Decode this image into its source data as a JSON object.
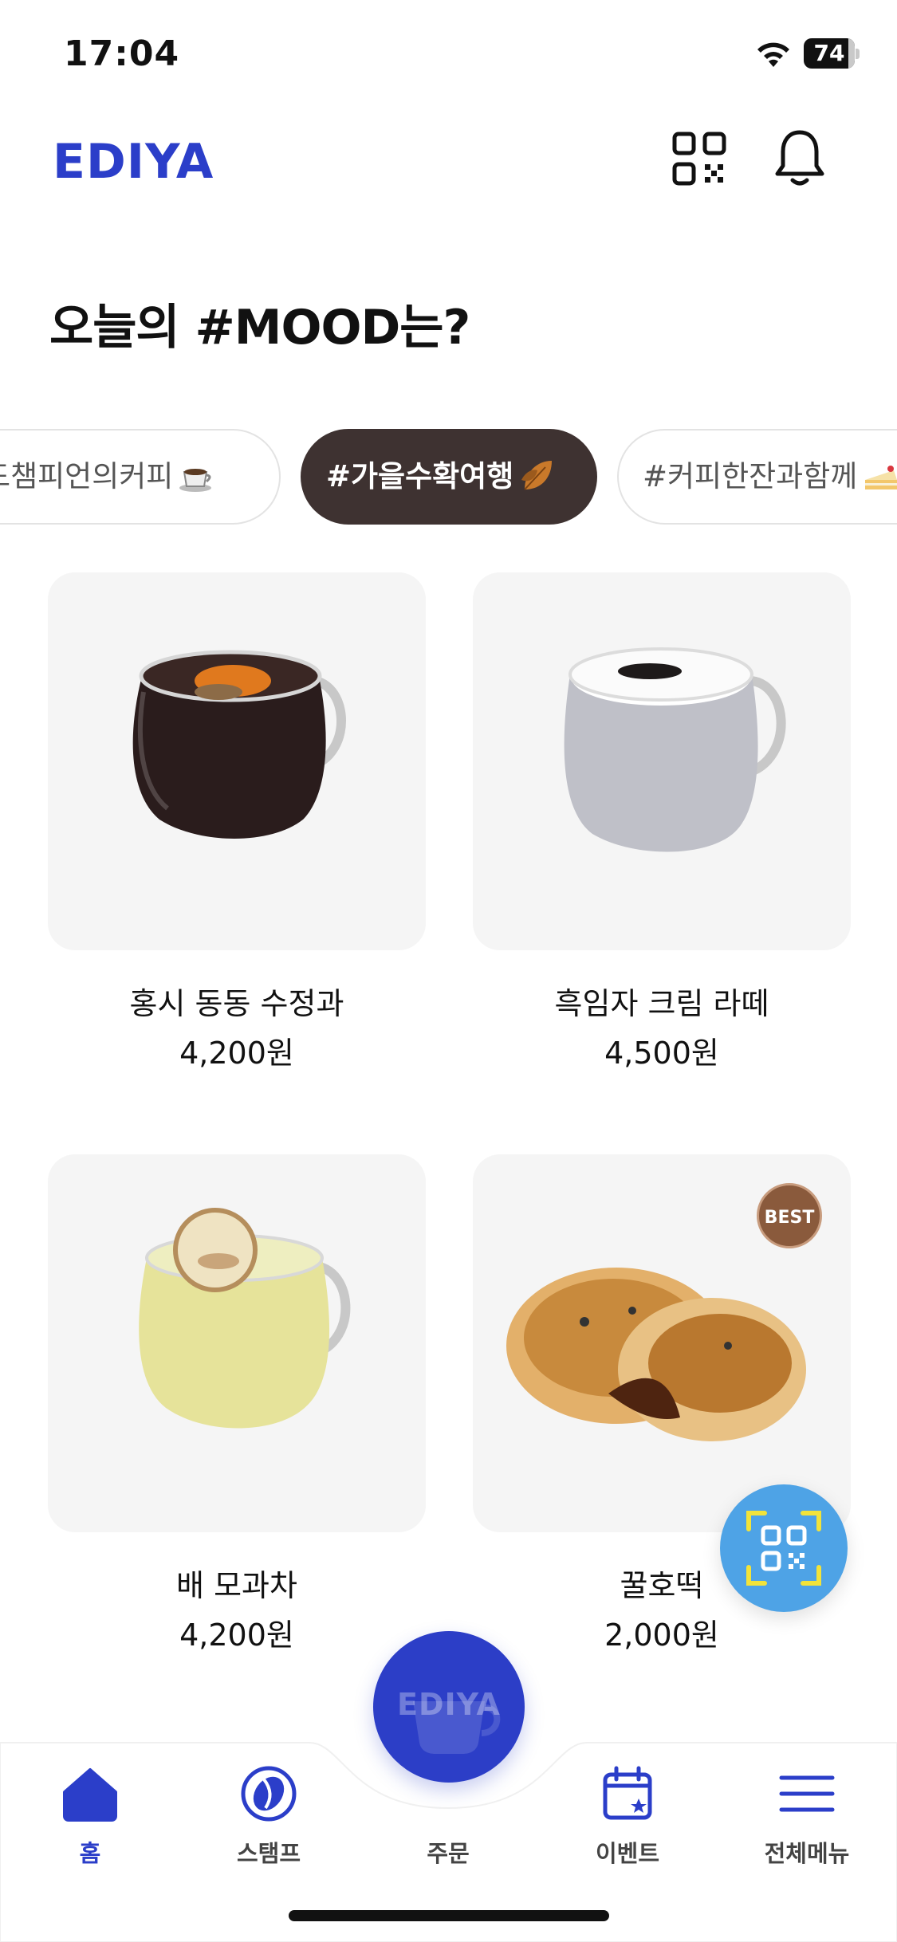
{
  "status_bar": {
    "time": "17:04",
    "battery": "74"
  },
  "header": {
    "logo": "EDIYA",
    "qr_icon": "qr-code-icon",
    "bell_icon": "bell-icon"
  },
  "mood": {
    "title": "오늘의 #MOOD는?"
  },
  "chips": [
    {
      "label": "#월드챔피언의커피",
      "emoji": "coffee-cup-icon",
      "active": false
    },
    {
      "label": "#가을수확여행",
      "emoji": "autumn-leaf-icon",
      "active": true
    },
    {
      "label": "#커피한잔과함께",
      "emoji": "cake-icon",
      "active": false
    }
  ],
  "products": [
    {
      "name": "홍시 동동 수정과",
      "price": "4,200원",
      "badge": ""
    },
    {
      "name": "흑임자 크림 라떼",
      "price": "4,500원",
      "badge": ""
    },
    {
      "name": "배 모과차",
      "price": "4,200원",
      "badge": ""
    },
    {
      "name": "꿀호떡",
      "price": "2,000원",
      "badge": "BEST"
    }
  ],
  "fab": {
    "icon": "qr-scan-icon"
  },
  "tabbar": {
    "items": [
      {
        "label": "홈",
        "icon": "home-icon",
        "active": true
      },
      {
        "label": "스탬프",
        "icon": "coffee-bean-icon",
        "active": false
      },
      {
        "label": "주문",
        "icon": "ediya-cup-icon",
        "active": false
      },
      {
        "label": "이벤트",
        "icon": "calendar-icon",
        "active": false
      },
      {
        "label": "전체메뉴",
        "icon": "menu-icon",
        "active": false
      }
    ],
    "order_logo": "EDIYA"
  },
  "colors": {
    "brand": "#2b3ec9",
    "active_chip": "#3e3231",
    "fab": "#4ea3e6",
    "best_badge": "#8a5a3c"
  }
}
